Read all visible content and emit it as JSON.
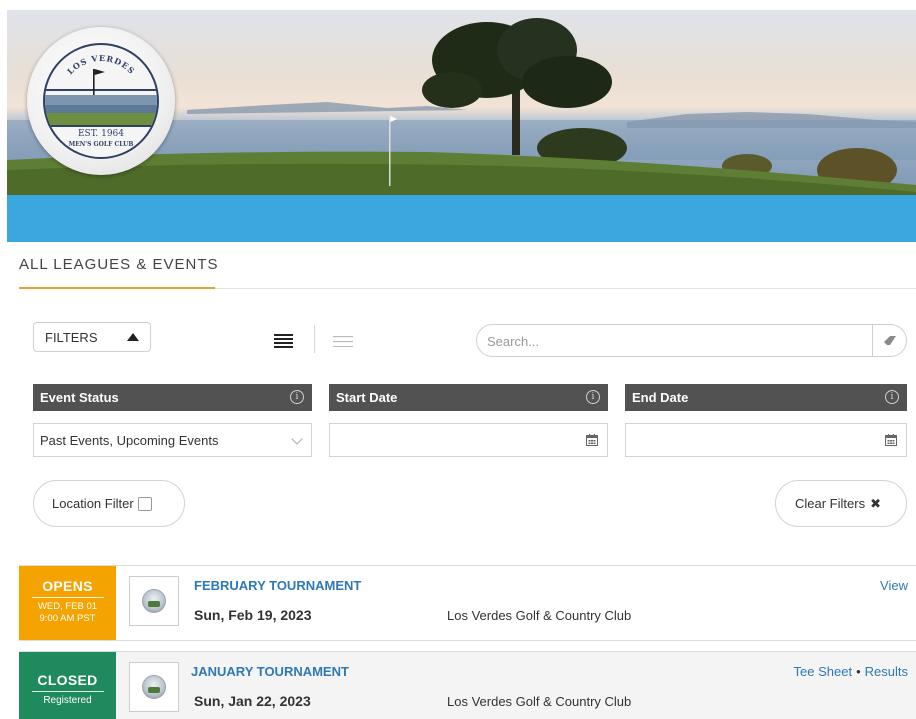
{
  "header": {
    "logo_text_top": "LOS VERDES",
    "logo_text_est": "EST. 1964",
    "logo_text_bottom": "MEN'S GOLF CLUB"
  },
  "section_title": "ALL LEAGUES & EVENTS",
  "toolbar": {
    "filters_label": "FILTERS",
    "search_placeholder": "Search..."
  },
  "filters": {
    "event_status": {
      "label": "Event Status",
      "value": "Past Events, Upcoming Events"
    },
    "start_date": {
      "label": "Start Date",
      "value": ""
    },
    "end_date": {
      "label": "End Date",
      "value": ""
    },
    "location_filter_label": "Location Filter",
    "clear_filters_label": "Clear Filters"
  },
  "events": [
    {
      "status": "OPENS",
      "status_line1": "WED, FEB 01",
      "status_line2": "9:00 AM PST",
      "status_color": "#f5a300",
      "name": "FEBRUARY TOURNAMENT",
      "date": "Sun, Feb 19, 2023",
      "location": "Los Verdes Golf & Country Club",
      "links": [
        "View"
      ]
    },
    {
      "status": "CLOSED",
      "status_line1": "Registered",
      "status_color": "#1f8a5b",
      "name": "JANUARY TOURNAMENT",
      "date": "Sun, Jan 22, 2023",
      "location": "Los Verdes Golf & Country Club",
      "links": [
        "Tee Sheet",
        "Results"
      ]
    }
  ],
  "icons": {
    "filters_toggle": "caret-up-icon",
    "list_view": "list-view-icon",
    "compact_view": "compact-view-icon",
    "search_clear": "eraser-icon",
    "info": "info-icon",
    "calendar": "calendar-icon",
    "clear": "close-icon"
  }
}
